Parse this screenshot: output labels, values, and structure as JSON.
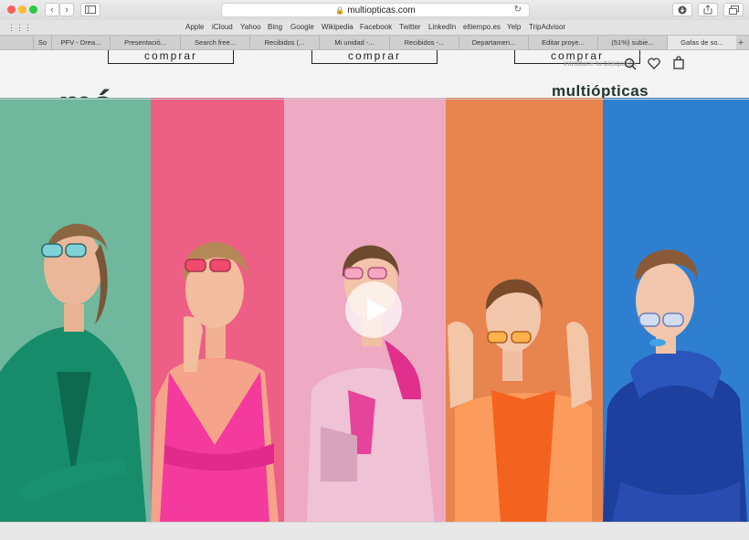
{
  "browser": {
    "url": "multiopticas.com",
    "bookmarks": [
      "Apple",
      "iCloud",
      "Yahoo",
      "Bing",
      "Google",
      "Wikipedia",
      "Facebook",
      "Twitter",
      "LinkedIn",
      "eltiempo.es",
      "Yelp",
      "TripAdvisor"
    ],
    "tabs": [
      {
        "label": "So"
      },
      {
        "label": "PFV - Drea..."
      },
      {
        "label": "Presentació..."
      },
      {
        "label": "Search free..."
      },
      {
        "label": "Recibidos (..."
      },
      {
        "label": "Mi unidad -..."
      },
      {
        "label": "Recibidos -..."
      },
      {
        "label": "Departamen..."
      },
      {
        "label": "Editar proye..."
      },
      {
        "label": "(51%) subie..."
      },
      {
        "label": "Gafas de so..."
      }
    ],
    "new_tab": "+"
  },
  "page": {
    "comprar_label": "comprar",
    "partial_text": "mó",
    "search_placeholder": "introduce tu búsqueda",
    "logo_text": "multiópticas",
    "stripe_colors": [
      "#6fb79d",
      "#ee5f85",
      "#eea9c3",
      "#e8854f",
      "#2f7fd0"
    ]
  }
}
